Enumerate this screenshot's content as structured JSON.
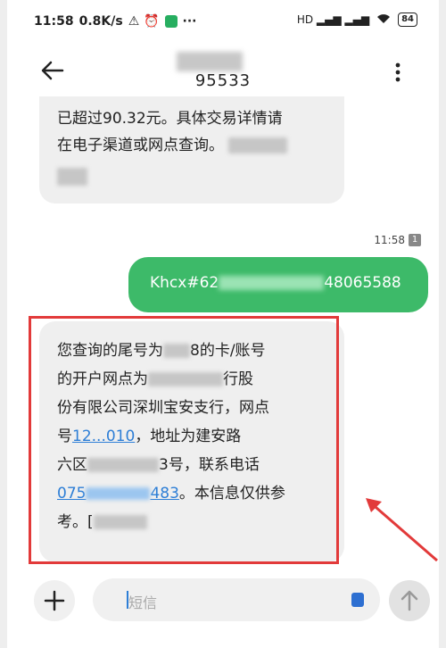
{
  "status_bar": {
    "time": "11:58",
    "speed": "0.8K/s",
    "extras": "⚠ ⏰",
    "more": "···",
    "signal": "HD ▂▄▆ ▂▄▆",
    "battery": "84"
  },
  "header": {
    "number": "95533",
    "back_icon": "back-arrow-icon",
    "more_icon": "more-vertical-icon"
  },
  "messages": {
    "received_1": {
      "line1": "已超过90.32元。具体交易详情请",
      "line2": "在电子渠道或网点查询。"
    },
    "time_label": "11:58",
    "sim_label": "1",
    "sent": {
      "prefix": "Khcx#62",
      "suffix": "48065588"
    },
    "received_2": {
      "l1a": "您查询的尾号为",
      "l1b": "8的卡/账号",
      "l2a": "的开户网点为",
      "l2b": "行股",
      "l3": "份有限公司深圳宝安支行，网点",
      "l4a": "号",
      "l4link": "12...010",
      "l4b": "，地址为建安路",
      "l5a": "六区",
      "l5b": "3号，联系电话",
      "l6link_a": "075",
      "l6link_b": "483",
      "l6b": "。本信息仅供参",
      "l7a": "考。[",
      "l7b": ""
    }
  },
  "input_bar": {
    "placeholder": "短信",
    "add_icon": "plus-icon",
    "send_icon": "send-arrow-icon"
  },
  "annotation": {
    "color": "#e23a3a"
  },
  "colors": {
    "sent_bubble": "#3dba69",
    "link": "#2d7ed6"
  }
}
